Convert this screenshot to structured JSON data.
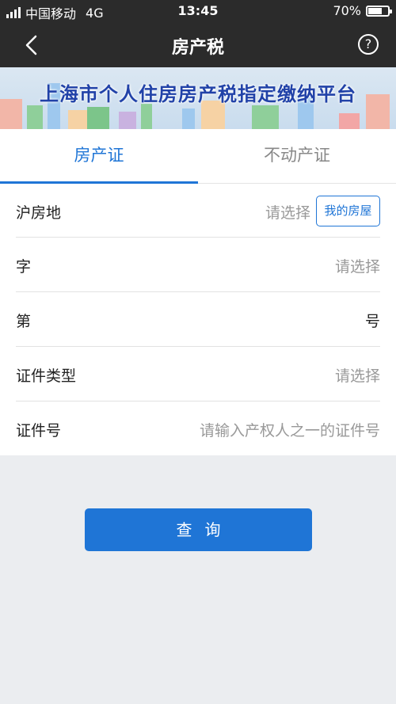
{
  "status_bar": {
    "carrier": "中国移动",
    "network": "4G",
    "time": "13:45",
    "battery_text": "70%",
    "battery_level": 0.7
  },
  "nav": {
    "title": "房产税",
    "back_icon": "chevron-left-icon",
    "help_icon": "question-circle-icon",
    "help_glyph": "?"
  },
  "banner": {
    "title": "上海市个人住房房产税指定缴纳平台"
  },
  "tabs": [
    {
      "label": "房产证",
      "active": true
    },
    {
      "label": "不动产证",
      "active": false
    }
  ],
  "form": {
    "rows": [
      {
        "label": "沪房地",
        "value": "请选择",
        "button": "我的房屋"
      },
      {
        "label": "字",
        "value": "请选择"
      },
      {
        "label": "第",
        "value": "号"
      },
      {
        "label": "证件类型",
        "value": "请选择"
      },
      {
        "label": "证件号",
        "placeholder": "请输入产权人之一的证件号"
      }
    ]
  },
  "actions": {
    "query_label": "查询"
  },
  "colors": {
    "accent": "#1f75d6",
    "navbar": "#2b2b2b",
    "banner_title": "#2142a8",
    "page_bg": "#ebedf0"
  }
}
